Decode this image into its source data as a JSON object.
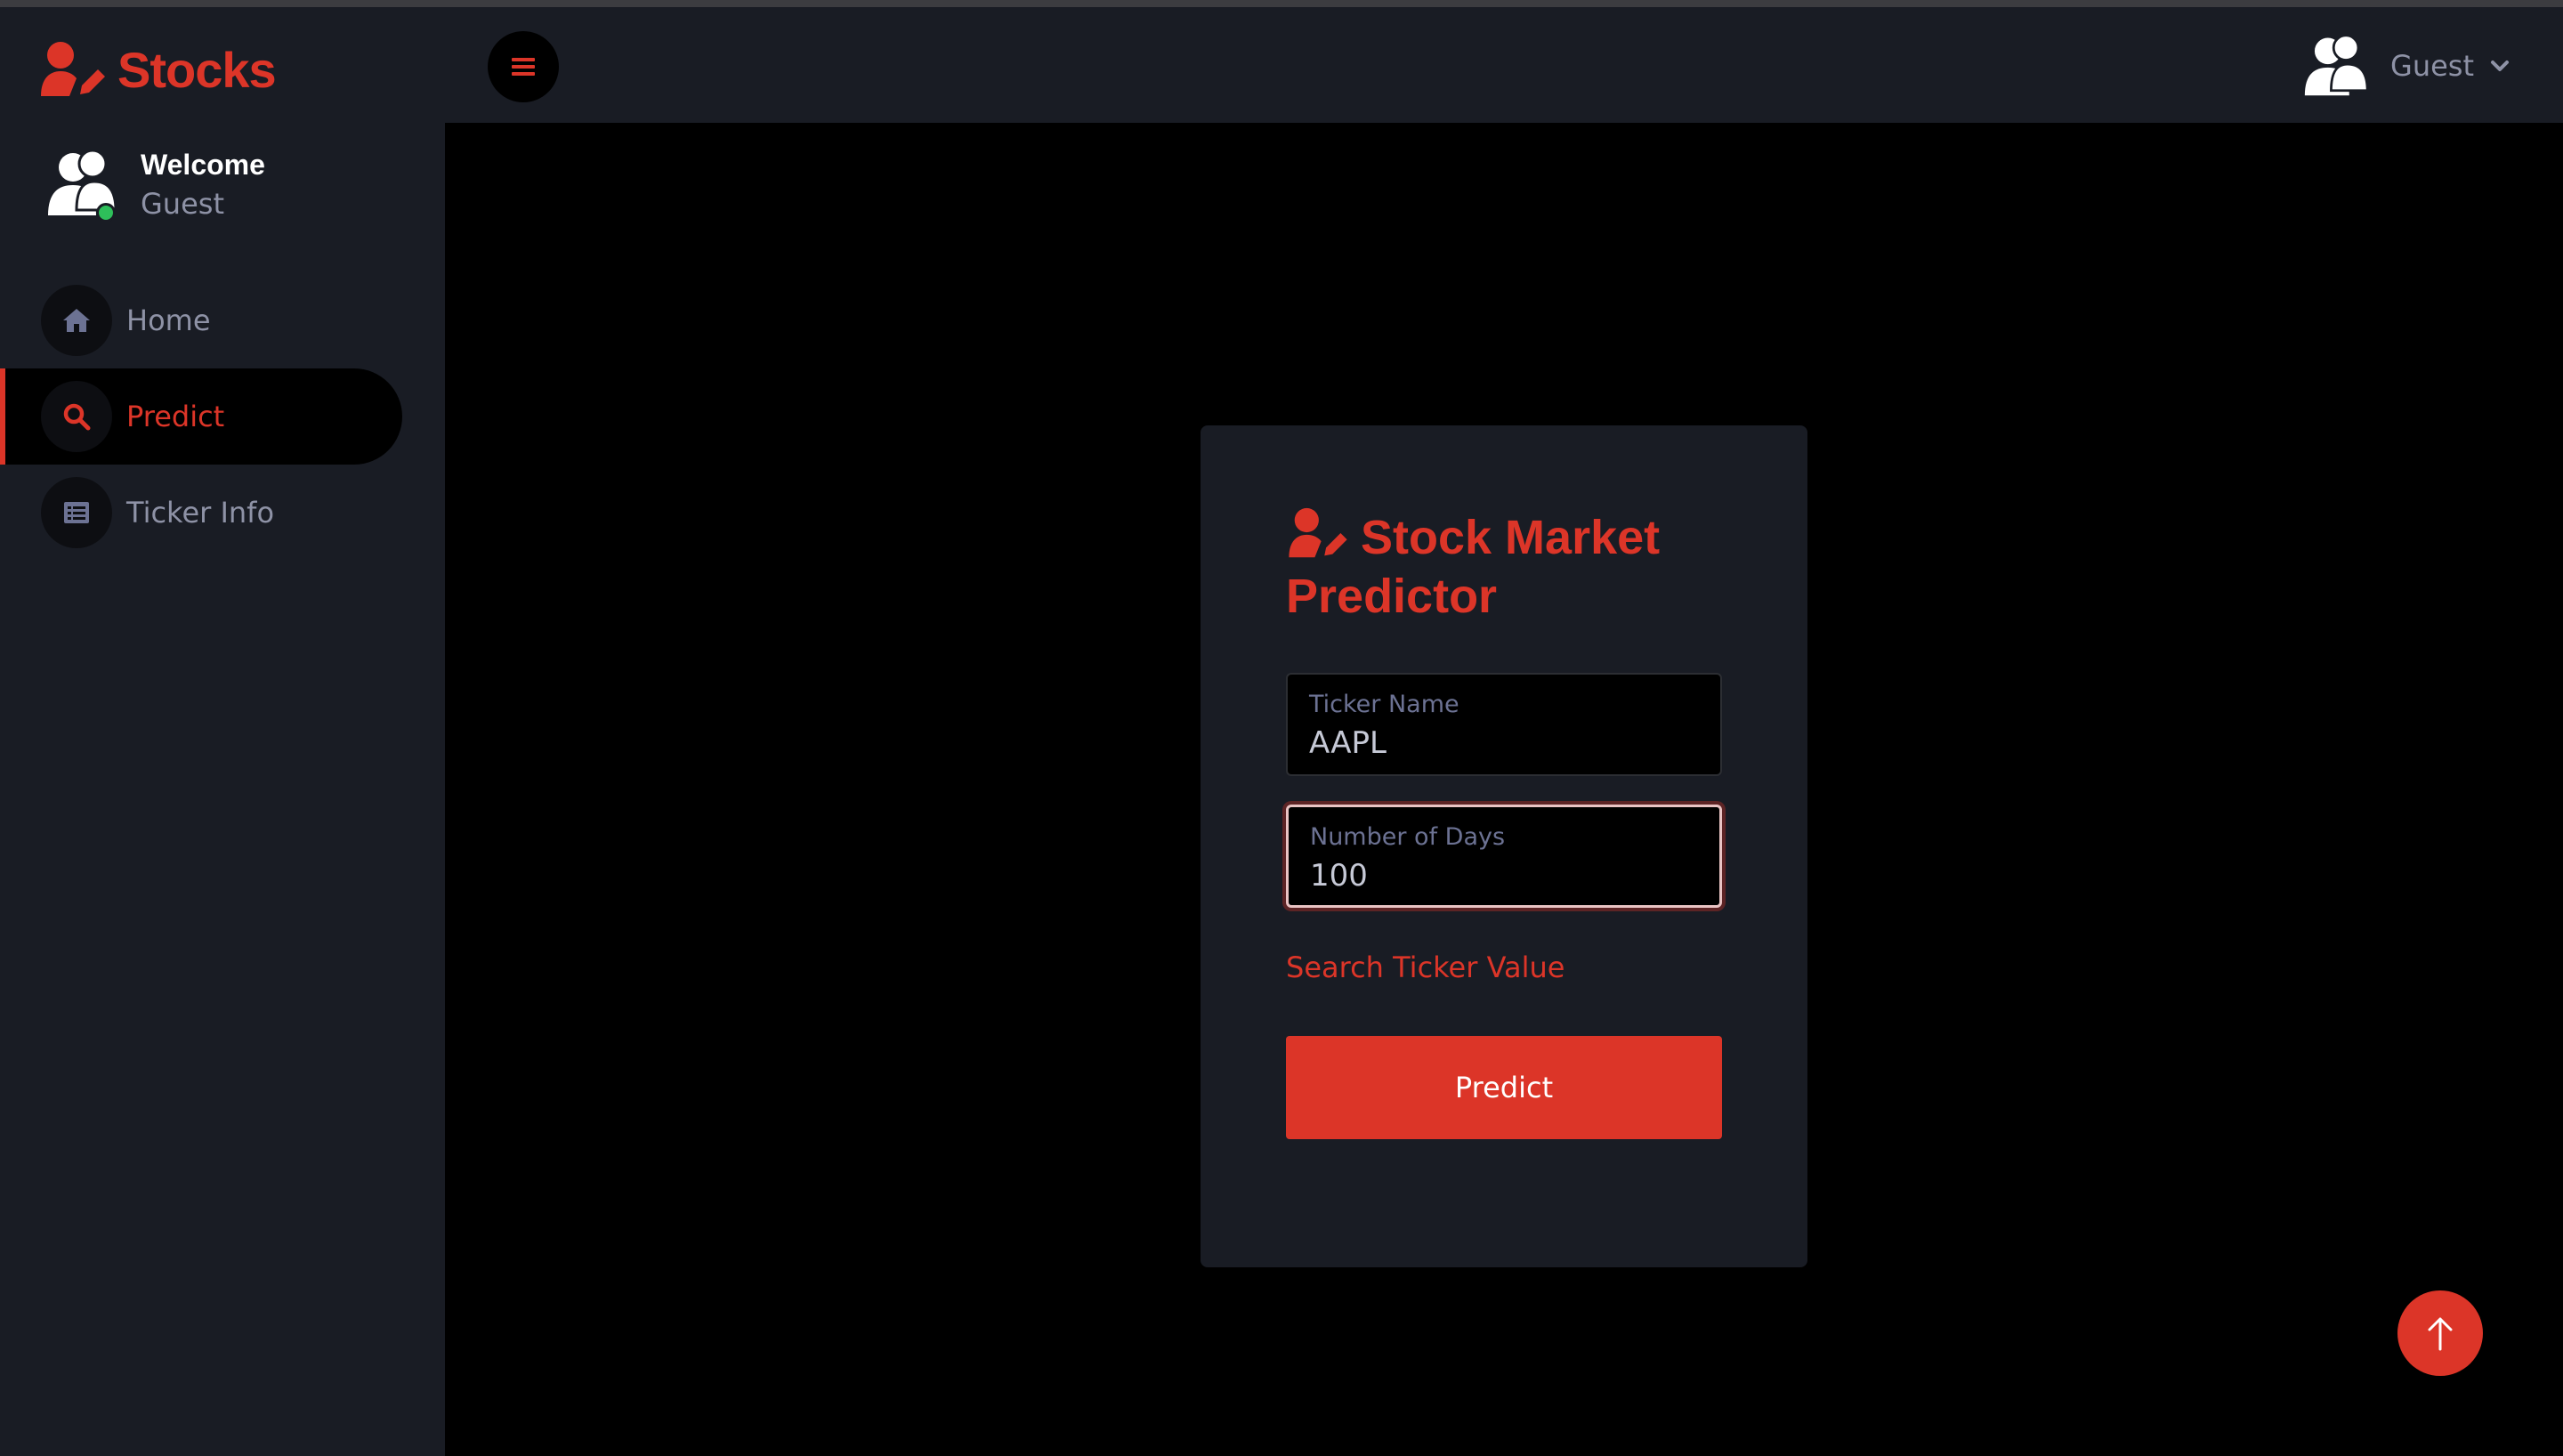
{
  "app": {
    "brand_name": "Stocks",
    "brand_icon": "user-edit-icon",
    "accent_color": "#dc3528",
    "sidebar_bg": "#191c24",
    "content_bg": "#000000"
  },
  "sidebar": {
    "profile": {
      "welcome": "Welcome",
      "name": "Guest",
      "status": "online",
      "avatar_icon": "users-icon"
    },
    "items": [
      {
        "label": "Home",
        "icon": "home-icon",
        "active": false
      },
      {
        "label": "Predict",
        "icon": "search-icon",
        "active": true
      },
      {
        "label": "Ticker Info",
        "icon": "list-icon",
        "active": false
      }
    ]
  },
  "topbar": {
    "menu_icon": "hamburger-menu-icon",
    "user": {
      "name": "Guest",
      "avatar_icon": "users-icon",
      "dropdown_icon": "chevron-down-icon"
    }
  },
  "form": {
    "title": "Stock Market Predictor",
    "title_icon": "user-edit-icon",
    "ticker": {
      "label": "Ticker Name",
      "value": "AAPL"
    },
    "days": {
      "label": "Number of Days",
      "value": "100",
      "focused": true
    },
    "search_link": "Search Ticker Value",
    "submit_label": "Predict"
  },
  "scroll_top_icon": "arrow-up-icon"
}
